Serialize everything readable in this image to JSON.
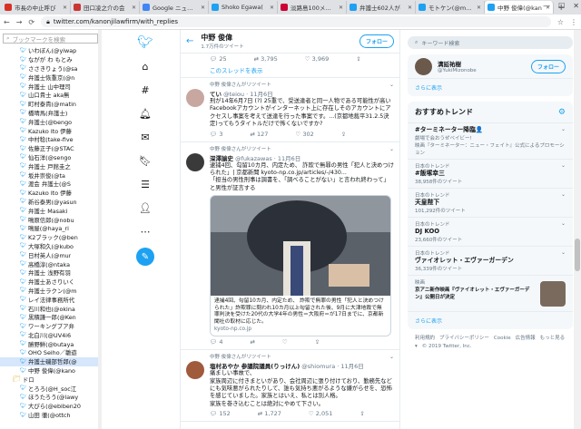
{
  "browser": {
    "tabs": [
      {
        "label": "市長の中止呼び",
        "color": "#d93025"
      },
      {
        "label": "田口凌之介の会",
        "color": "#cc3333"
      },
      {
        "label": "Google ニュース",
        "color": "#4285f4"
      },
      {
        "label": "Shoko Egawa(",
        "color": "#1da1f2"
      },
      {
        "label": "淡路島100メート",
        "color": "#cc0033"
      },
      {
        "label": "弁護士602人が",
        "color": "#1da1f2"
      },
      {
        "label": "モトケン(@moto",
        "color": "#1da1f2"
      },
      {
        "label": "中野 俊偉(@kan",
        "color": "#1da1f2",
        "active": true
      }
    ],
    "url": "twitter.com/kanonjilawfirm/with_replies"
  },
  "bookmarks": {
    "search_placeholder": "ブックマークを検索",
    "items": [
      {
        "label": "いわぼん(@yiwap"
      },
      {
        "label": "ながが わ もとみ"
      },
      {
        "label": "ささきりょう(@sa"
      },
      {
        "label": "弁護士恢重京(@n"
      },
      {
        "label": "弁護士 山中理司"
      },
      {
        "label": "山口貴士 aka無"
      },
      {
        "label": "町村泰貴(@matin"
      },
      {
        "label": "橋晴馬(弁護士)"
      },
      {
        "label": "弁護士(@bengo"
      },
      {
        "label": "Kazuko Ito 伊藤"
      },
      {
        "label": "中村稔(take-five"
      },
      {
        "label": "佐藤正子(@STAC"
      },
      {
        "label": "仙石洋(@sengo"
      },
      {
        "label": "弁護士 戸館圭之"
      },
      {
        "label": "坂井崇俊(@ta"
      },
      {
        "label": "渡会 弁護士(@S"
      },
      {
        "label": "Kazuko Ito 伊藤"
      },
      {
        "label": "新谷泰男(@yasun"
      },
      {
        "label": "弁護士 Masaki"
      },
      {
        "label": "鳴原信郎(@nobu"
      },
      {
        "label": "鳴屋(@haya_ri"
      },
      {
        "label": "K2ブラック(@ben"
      },
      {
        "label": "大塚和久(@kubo"
      },
      {
        "label": "日村英人(@mur"
      },
      {
        "label": "高橋淳(@ntaka"
      },
      {
        "label": "弁護士 浅野有羽"
      },
      {
        "label": "弁護士あさりいく"
      },
      {
        "label": "弁護士ラクン(@m"
      },
      {
        "label": "レイ法律事務所代"
      },
      {
        "label": "石川和也(@okina"
      },
      {
        "label": "黒積謙一郎(@Ken"
      },
      {
        "label": "ワーキングプア弁"
      },
      {
        "label": "北白川(@UV4i6"
      },
      {
        "label": "勝野鮮(@butaya"
      },
      {
        "label": "OHO Seiho／雛遊"
      },
      {
        "label": "弁護士磯部哲郎(@",
        "selected": true
      },
      {
        "label": "中野 俊偉(@kano"
      },
      {
        "label": "ドロ",
        "folder": true
      },
      {
        "label": "とろろ(@H_soc江"
      },
      {
        "label": "ほうたろう(@lawy"
      },
      {
        "label": "大ぴら(@ebiben20"
      },
      {
        "label": "山田 徹(@ottch"
      }
    ]
  },
  "timeline": {
    "header": {
      "name": "中野 俊偉",
      "sub": "1.7万件のツイート",
      "follow_label": "フォロー"
    },
    "top_actions": {
      "reply": "25",
      "retweet": "3,795",
      "like": "3,969"
    },
    "show_thread": "このスレッドを表示",
    "tweets": [
      {
        "retweeter": "中野 俊偉さんがリツイート",
        "name": "てい",
        "handle": "@teiou · 11月6日",
        "text": "刑が14年6月7日 (?) 25重で、受送達者と同一人物である可能性が高いFacebookアカウントがインターネット上に存在しそのアカウントにアクセスし事案を考えて送達を行った事案です。...(京都地裁平31.2.5決定)ってもうタイトルだけで怖くないですか?",
        "reply": "3",
        "retweet": "127",
        "like": "302",
        "avatar_color": "#c7a7a0"
      },
      {
        "retweeter": "中野 俊偉さんがリツイート",
        "name": "深澤諭史",
        "handle": "@fukazawas · 11月6日",
        "text": "逮捕4回、勾留10カ月、内定ため、 詐欺で無罪の男性「犯人と決めつけられた」| 京都新聞 kyoto-np.co.jp/articles/-/430...\n「担当の男性刑事は調書を、「調べることがない」と言われ終わって」と男性が証言する",
        "card_text": "逮捕4回、勾留10カ月、内定ため、 詐欺で無罪の男性「犯人と決めつけられた」詐欺罪に問われ10カ月以上勾留された後、9月に大津地裁で無罪判決を受けた20代の大学4年の男性＝大阪府＝が17日までに、京都新聞社の取材に応じた。",
        "card_src": "kyoto-np.co.jp",
        "reply": "4",
        "retweet": "",
        "like": "",
        "avatar_color": "#3a3a3a"
      },
      {
        "retweeter": "中野 俊偉さんがリツイート",
        "name": "塩村あやか 参議院議員(りっけん)",
        "handle": "@shiomura · 11月6日",
        "text": "痛ましい事故で、\n家族周辺に付きまといがあり、会社周辺に張り付けており、勤務先などにも気味悪がられたりして、誰も気持ち悪がるような嫌がらせを、恐怖を感じていました。家族とはいえ、私とは別人格。\n家族を巻き込むことは絶対にやめて下さい。",
        "reply": "152",
        "retweet": "1,727",
        "like": "2,051",
        "avatar_color": "#a05a3c"
      }
    ]
  },
  "rightcol": {
    "search_placeholder": "キーワード検索",
    "recommend": {
      "name": "溝延祐樹",
      "handle": "@YukiMizonobe",
      "follow_label": "フォロー"
    },
    "see_more": "さらに表示",
    "trends_title": "おすすめトレンド",
    "trends": [
      {
        "context": "",
        "name": "#ターミネーター降臨👤",
        "desc": "劇場で会おうぜベイビー!",
        "count": "",
        "promoted": "映画『ターミネーター：ニュー・フェイト』公式によるプロモーション"
      },
      {
        "context": "日本のトレンド",
        "name": "#飯塚幸三",
        "count": "38,958件のツイート"
      },
      {
        "context": "日本のトレンド",
        "name": "天皇陛下",
        "count": "101,292件のツイート"
      },
      {
        "context": "日本のトレンド",
        "name": "DJ KOO",
        "count": "23,660件のツイート"
      },
      {
        "context": "日本のトレンド",
        "name": "ヴァイオレット・エヴァーガーデン",
        "count": "36,339件のツイート"
      },
      {
        "context": "映画",
        "name": "",
        "desc": "京アニ新作映画『ヴァイオレット・エヴァーガーデン』公開日が決定",
        "count": "",
        "thumb": true
      }
    ],
    "see_more2": "さらに表示",
    "footer": [
      "利用規約",
      "プライバシーポリシー",
      "Cookie",
      "広告情報",
      "もっと見る ▾",
      "© 2019 Twitter, Inc."
    ]
  }
}
